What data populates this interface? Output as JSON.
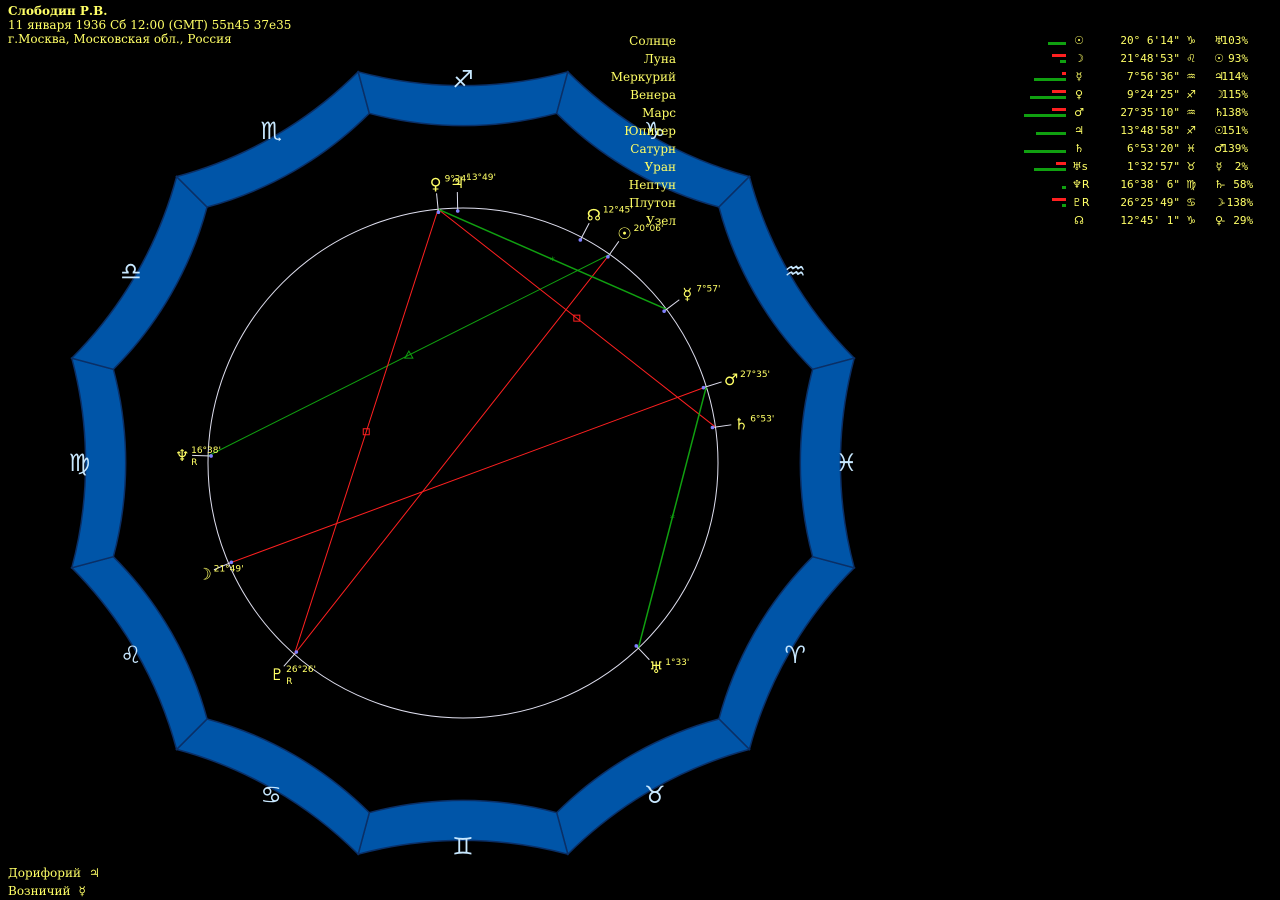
{
  "header": {
    "name": "Слободин Р.В.",
    "datetime": "11 января 1936  Сб  12:00 (GMT)  55n45  37e35",
    "place": "г.Москва, Московская обл., Россия"
  },
  "bottom": [
    {
      "label": "Дорифорий",
      "glyph": "♃",
      "icon": "jupiter-icon"
    },
    {
      "label": "Возничий",
      "glyph": "☿",
      "icon": "mercury-icon"
    }
  ],
  "zodiac": [
    {
      "name": "aries",
      "glyph": "♈"
    },
    {
      "name": "taurus",
      "glyph": "♉"
    },
    {
      "name": "gemini",
      "glyph": "♊"
    },
    {
      "name": "cancer",
      "glyph": "♋"
    },
    {
      "name": "leo",
      "glyph": "♌"
    },
    {
      "name": "virgo",
      "glyph": "♍"
    },
    {
      "name": "libra",
      "glyph": "♎"
    },
    {
      "name": "scorpio",
      "glyph": "♏"
    },
    {
      "name": "sagittarius",
      "glyph": "♐"
    },
    {
      "name": "capricorn",
      "glyph": "♑"
    },
    {
      "name": "aquarius",
      "glyph": "♒"
    },
    {
      "name": "pisces",
      "glyph": "♓"
    }
  ],
  "colors": {
    "ring": "#0055a8",
    "ring_border": "#0a2f66",
    "zodiac_glyph": "#c8e8ff",
    "circle": "#e0e0f0",
    "text": "#ffff66",
    "tick": "#8080ff",
    "aspect_red": "#ff2020",
    "aspect_green": "#10a010"
  },
  "wheel_points": [
    {
      "key": "sun",
      "glyph": "☉",
      "lon": 290.1,
      "label": "20°06'",
      "retro": ""
    },
    {
      "key": "node",
      "glyph": "☊",
      "lon": 282.75,
      "label": "12°45'",
      "retro": ""
    },
    {
      "key": "jupiter",
      "glyph": "♃",
      "lon": 253.8,
      "label": "13°49'",
      "retro": ""
    },
    {
      "key": "venus",
      "glyph": "♀",
      "lon": 249.4,
      "label": "9°24'",
      "retro": ""
    },
    {
      "key": "mercury",
      "glyph": "☿",
      "lon": 307.95,
      "label": "7°57'",
      "retro": ""
    },
    {
      "key": "mars",
      "glyph": "♂",
      "lon": 327.6,
      "label": "27°35'",
      "retro": ""
    },
    {
      "key": "saturn",
      "glyph": "♄",
      "lon": 336.9,
      "label": "6°53'",
      "retro": ""
    },
    {
      "key": "uranus",
      "glyph": "♅",
      "lon": 31.55,
      "label": "1°33'",
      "retro": ""
    },
    {
      "key": "neptune",
      "glyph": "♆",
      "lon": 166.6,
      "label": "16°38'",
      "retro": "R"
    },
    {
      "key": "moon",
      "glyph": "☽",
      "lon": 141.8,
      "label": "21°49'",
      "retro": ""
    },
    {
      "key": "pluto",
      "glyph": "♇",
      "lon": 116.4,
      "label": "26°26'",
      "retro": "R"
    }
  ],
  "aspects": [
    {
      "from": "sun",
      "to": "pluto",
      "kind": "opposition"
    },
    {
      "from": "mars",
      "to": "moon",
      "kind": "opposition"
    },
    {
      "from": "sun",
      "to": "neptune",
      "kind": "trine"
    },
    {
      "from": "venus",
      "to": "saturn",
      "kind": "square"
    },
    {
      "from": "venus",
      "to": "pluto",
      "kind": "square"
    },
    {
      "from": "mercury",
      "to": "venus",
      "kind": "sextile"
    },
    {
      "from": "mars",
      "to": "uranus",
      "kind": "sextile"
    }
  ],
  "table": [
    {
      "name": "Солнце",
      "icon": "sun-icon",
      "glyph": "☉",
      "red": 0,
      "green": 18,
      "pos": "20° 6'14\"",
      "sign": "♑",
      "ruler": "♅",
      "pct": "103%"
    },
    {
      "name": "Луна",
      "icon": "moon-icon",
      "glyph": "☽",
      "red": 14,
      "green": 6,
      "pos": "21°48'53\"",
      "sign": "♌",
      "ruler": "☉",
      "pct": "93%"
    },
    {
      "name": "Меркурий",
      "icon": "mercury-icon",
      "glyph": "☿",
      "red": 4,
      "green": 32,
      "pos": "7°56'36\"",
      "sign": "♒",
      "ruler": "♃",
      "pct": "114%"
    },
    {
      "name": "Венера",
      "icon": "venus-icon",
      "glyph": "♀",
      "red": 14,
      "green": 36,
      "pos": "9°24'25\"",
      "sign": "♐",
      "ruler": "☽",
      "pct": "115%"
    },
    {
      "name": "Марс",
      "icon": "mars-icon",
      "glyph": "♂",
      "red": 14,
      "green": 42,
      "pos": "27°35'10\"",
      "sign": "♒",
      "ruler": "♄",
      "pct": "138%"
    },
    {
      "name": "Юпитер",
      "icon": "jupiter-icon",
      "glyph": "♃",
      "red": 0,
      "green": 30,
      "pos": "13°48'58\"",
      "sign": "♐",
      "ruler": "☉",
      "pct": "151%"
    },
    {
      "name": "Сатурн",
      "icon": "saturn-icon",
      "glyph": "♄",
      "red": 0,
      "green": 42,
      "pos": "6°53'20\"",
      "sign": "♓",
      "ruler": "♂",
      "pct": "139%"
    },
    {
      "name": "Уран",
      "icon": "uranus-icon",
      "glyph": "♅s",
      "red": 10,
      "green": 32,
      "pos": "1°32'57\"",
      "sign": "♉",
      "ruler": "☿",
      "pct": "2%"
    },
    {
      "name": "Нептун",
      "icon": "neptune-icon",
      "glyph": "♆R",
      "red": 0,
      "green": 4,
      "pos": "16°38' 6\"",
      "sign": "♍",
      "ruler": "♄",
      "pct": "- 58%"
    },
    {
      "name": "Плутон",
      "icon": "pluto-icon",
      "glyph": "♇R",
      "red": 14,
      "green": 4,
      "pos": "26°25'49\"",
      "sign": "♋",
      "ruler": "☽",
      "pct": "-138%"
    },
    {
      "name": "Узел",
      "icon": "node-icon",
      "glyph": "☊",
      "red": 0,
      "green": 0,
      "pos": "12°45' 1\"",
      "sign": "♑",
      "ruler": "♀",
      "pct": "- 29%"
    }
  ]
}
